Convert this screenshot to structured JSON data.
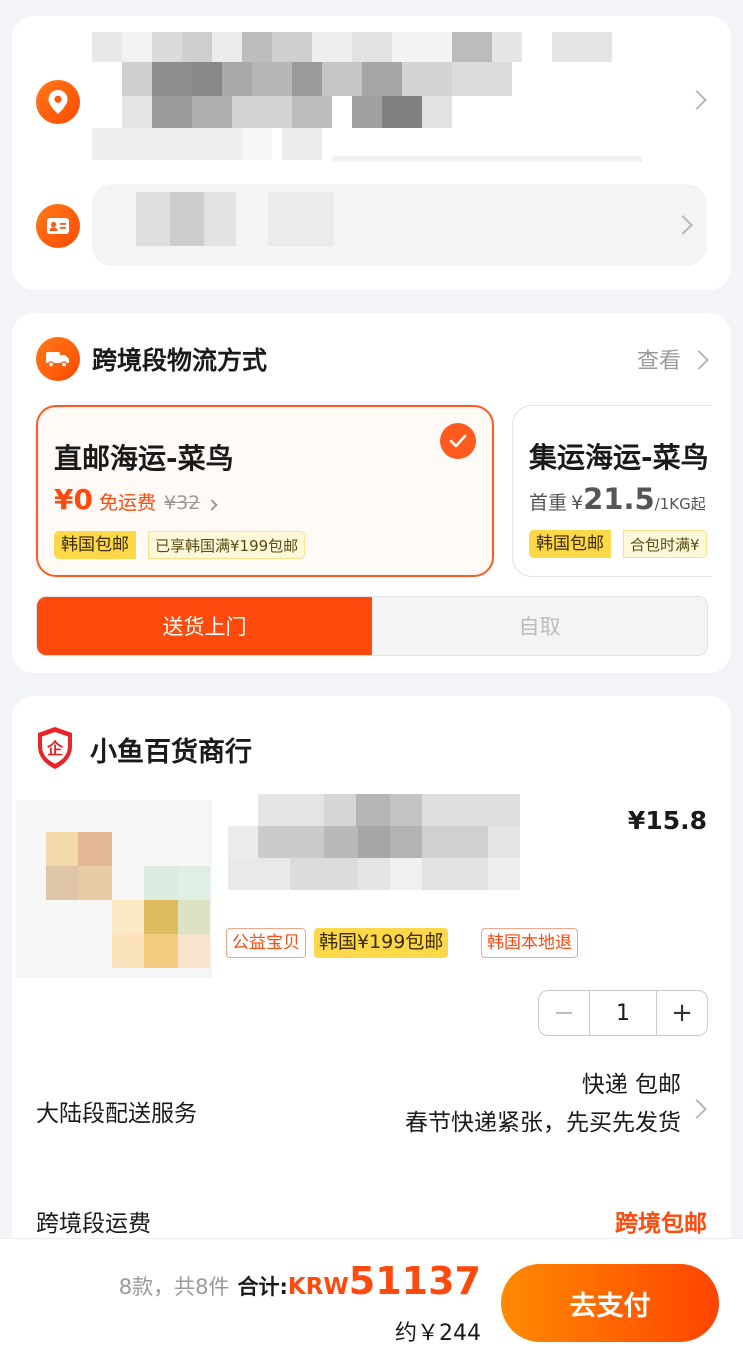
{
  "shipping": {
    "title": "跨境段物流方式",
    "view_label": "查看",
    "options": [
      {
        "name": "直邮海运-菜鸟",
        "price": "¥0",
        "free_label": "免运费",
        "orig_price": "¥32",
        "tag": "韩国包邮",
        "tag_note": "已享韩国满¥199包邮",
        "selected": true
      },
      {
        "name": "集运海运-菜鸟",
        "prefix": "首重",
        "currency": "¥",
        "price": "21.5",
        "unit": "/1KG起",
        "tag": "韩国包邮",
        "tag_note": "合包时满¥"
      }
    ],
    "delivery_tabs": [
      {
        "label": "送货上门",
        "active": true
      },
      {
        "label": "自取",
        "active": false
      }
    ]
  },
  "shop": {
    "name": "小鱼百货商行",
    "badge_glyph": "企",
    "item": {
      "price": "¥15.8",
      "tags": [
        "公益宝贝",
        "韩国¥199包邮",
        "韩国本地退"
      ],
      "quantity": "1",
      "minus": "−",
      "plus": "+"
    },
    "mainland_service": {
      "label": "大陆段配送服务",
      "value_line1": "快递 包邮",
      "value_line2": "春节快递紧张，先买先发货"
    },
    "crossborder_fee": {
      "label": "跨境段运费",
      "value": "跨境包邮"
    }
  },
  "footer": {
    "count_text": "8款，共8件",
    "total_label": "合计:",
    "currency": "KRW",
    "amount": "51137",
    "approx": "约￥244",
    "pay_label": "去支付"
  },
  "colors": {
    "accent": "#ff4a0e",
    "tag_yellow": "#ffd84a",
    "background": "#f2f4f7"
  }
}
